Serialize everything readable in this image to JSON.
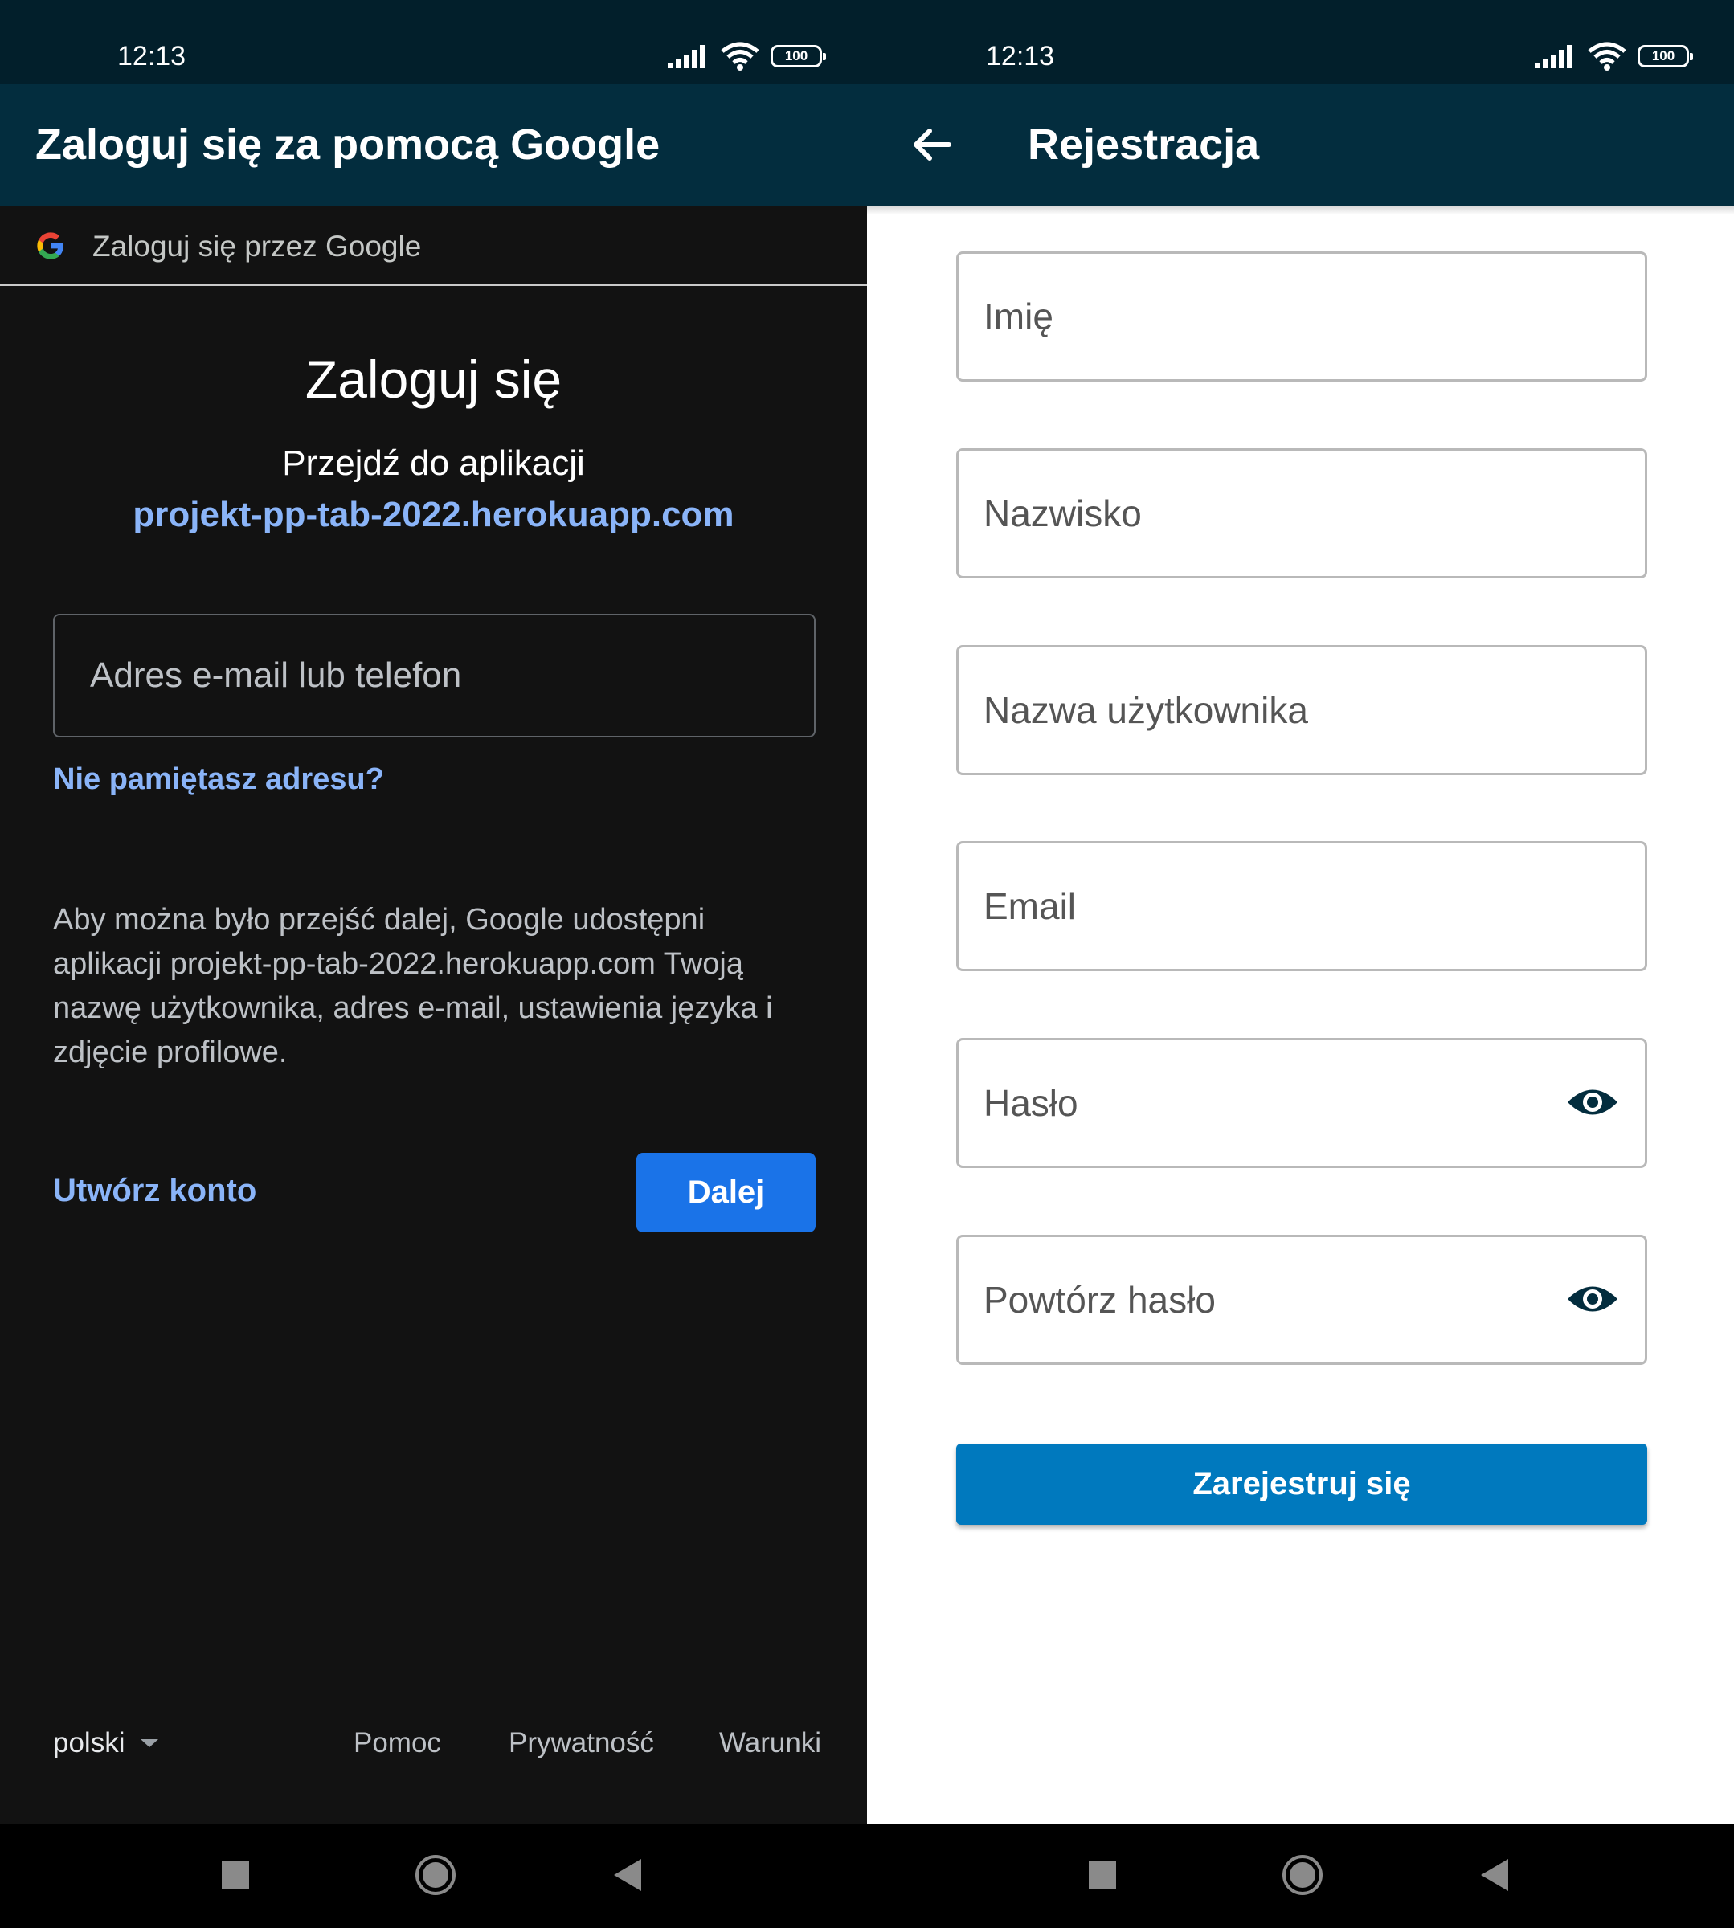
{
  "left_screen": {
    "status_time": "12:13",
    "battery": "100",
    "appbar_title": "Zaloguj się za pomocą Google",
    "google_bar_text": "Zaloguj się przez Google",
    "heading": "Zaloguj się",
    "subheading": "Przejdź do aplikacji",
    "app_domain": "projekt-pp-tab-2022.herokuapp.com",
    "email_placeholder": "Adres e-mail lub telefon",
    "forgot_link": "Nie pamiętasz adresu?",
    "info_text": "Aby można było przejść dalej, Google udostępni aplikacji projekt-pp-tab-2022.herokuapp.com Twoją nazwę użytkownika, adres e-mail, ustawienia języka i zdjęcie profilowe.",
    "create_account": "Utwórz konto",
    "next_button": "Dalej",
    "footer": {
      "language": "polski",
      "help": "Pomoc",
      "privacy": "Prywatność",
      "terms": "Warunki"
    }
  },
  "right_screen": {
    "status_time": "12:13",
    "battery": "100",
    "appbar_title": "Rejestracja",
    "fields": {
      "first_name": "Imię",
      "last_name": "Nazwisko",
      "username": "Nazwa użytkownika",
      "email": "Email",
      "password": "Hasło",
      "repeat_password": "Powtórz hasło"
    },
    "register_button": "Zarejestruj się"
  },
  "colors": {
    "status_bar": "#021f2b",
    "app_bar": "#032d3e",
    "google_dark_bg": "#121212",
    "google_link": "#8ab4f8",
    "google_button": "#1a73e8",
    "register_button": "#0079be"
  },
  "icons": [
    "signal-icon",
    "wifi-icon",
    "battery-icon",
    "google-logo-icon",
    "back-arrow-icon",
    "eye-icon",
    "dropdown-caret-icon",
    "nav-recents-icon",
    "nav-home-icon",
    "nav-back-icon"
  ]
}
